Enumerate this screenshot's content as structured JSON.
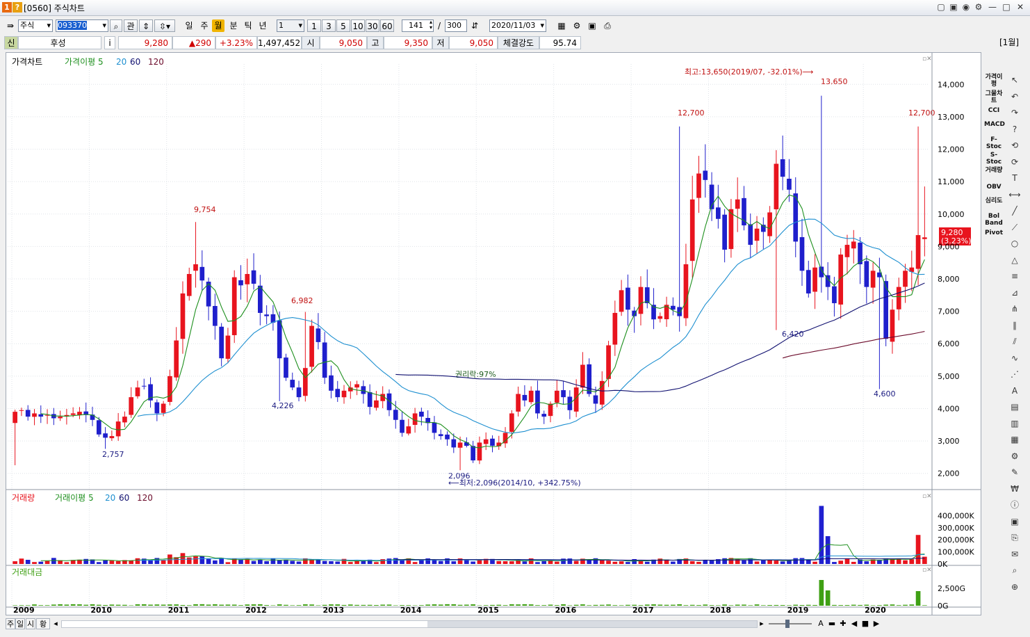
{
  "window": {
    "badge1": "1",
    "badge2": "?",
    "title": "[0560] 주식차트",
    "controls": [
      "▢",
      "▣",
      "◉",
      "⚙",
      "—",
      "□",
      "✕"
    ]
  },
  "toolbar": {
    "market": "주식",
    "code": "093370",
    "search_icon": "magnifier-icon",
    "gwan": "관",
    "periods": [
      "일",
      "주",
      "월",
      "분",
      "틱",
      "년"
    ],
    "selected_period": "월",
    "interval_value": "1",
    "intervals": [
      "1",
      "3",
      "5",
      "10",
      "30",
      "60"
    ],
    "count": "141",
    "slash": "/",
    "total": "300",
    "date": "2020/11/03"
  },
  "quote": {
    "sin": "신",
    "name": "후성",
    "info": "i",
    "price": "9,280",
    "change": "▲290",
    "change_pct": "+3.23%",
    "volume": "1,497,452",
    "open_label": "시",
    "open": "9,050",
    "high_label": "고",
    "high": "9,350",
    "low_label": "저",
    "low": "9,050",
    "strength_label": "체결강도",
    "strength": "95.74",
    "period_badge": "[1월]"
  },
  "colors": {
    "up": "#e8141e",
    "down": "#1f1fcc",
    "ma5": "#1d8f1d",
    "ma20": "#1d8fd0",
    "ma60": "#101070",
    "ma120": "#6b0a2a",
    "volume_up": "#e8141e",
    "volume_down": "#2020d0",
    "amount": "#3fa014"
  },
  "chart_data": [
    {
      "type": "candlestick",
      "title": "가격차트",
      "legend": [
        "가격차트",
        "가격이평 5",
        "20",
        "60",
        "120"
      ],
      "x_labels": [
        "2009",
        "2010",
        "2011",
        "2012",
        "2013",
        "2014",
        "2015",
        "2016",
        "2017",
        "2018",
        "2019",
        "2020"
      ],
      "y_ticks": [
        "14,000",
        "13,000",
        "12,000",
        "11,000",
        "10,000",
        "9,000",
        "8,000",
        "7,000",
        "6,000",
        "5,000",
        "4,000",
        "3,000",
        "2,000"
      ],
      "ylim": [
        1500,
        14500
      ],
      "monthly_close": [
        3900,
        3950,
        3750,
        3850,
        3750,
        3800,
        3700,
        3750,
        3800,
        3850,
        3900,
        3800,
        3650,
        3200,
        3100,
        3150,
        3600,
        3750,
        4350,
        4650,
        4700,
        4250,
        3850,
        4150,
        5000,
        6100,
        7550,
        8150,
        8450,
        7950,
        7150,
        6550,
        5550,
        6250,
        8050,
        7800,
        8150,
        7850,
        6950,
        6850,
        6650,
        5550,
        4950,
        4650,
        4350,
        5250,
        6550,
        6050,
        4950,
        4550,
        4350,
        4550,
        4650,
        4750,
        4450,
        4050,
        4250,
        4450,
        3950,
        3650,
        3250,
        3450,
        3850,
        3750,
        3550,
        3250,
        3150,
        3050,
        2800,
        2950,
        2850,
        2400,
        2950,
        3050,
        2850,
        2950,
        3250,
        3850,
        4450,
        4250,
        4550,
        3850,
        3750,
        4150,
        4550,
        4350,
        3950,
        4650,
        5350,
        4450,
        4150,
        4850,
        5950,
        6950,
        7650,
        7050,
        6850,
        7750,
        7250,
        6750,
        6850,
        7200,
        7050,
        6850,
        8450,
        10450,
        11250,
        11050,
        10150,
        9850,
        8900,
        10150,
        10450,
        9650,
        9050,
        9550,
        9450,
        10050,
        11550,
        11150,
        10750,
        9150,
        8250,
        7550,
        8350,
        8050,
        7750,
        7250,
        8750,
        9050,
        9150,
        8450,
        7750,
        8250,
        8050,
        6150,
        7050,
        7750,
        8250,
        8350,
        9350,
        9280
      ],
      "annotations": {
        "high_label": "최고:13,650(2019/07, -32.01%)⟶",
        "low_label": "⟵최저:2,096(2014/10, +342.75%)",
        "ex_rights": "권리락:97%",
        "peaks": [
          "9,754",
          "6,982",
          "12,700",
          "13,650",
          "12,700"
        ],
        "troughs": [
          "2,757",
          "4,226",
          "2,096",
          "6,420",
          "4,600"
        ],
        "last_price": "9,280",
        "last_change": "(3.23%)"
      }
    },
    {
      "type": "bar",
      "title": "거래량",
      "legend": [
        "거래량",
        "거래이평 5",
        "20",
        "60",
        "120"
      ],
      "y_ticks": [
        "400,000K",
        "300,000K",
        "200,000K",
        "100,000K",
        "0K"
      ],
      "ylim": [
        0,
        500000
      ],
      "unit": "K",
      "spikes": {
        "2019/06": 480000,
        "2019/07": 230000,
        "2020/09": 240000,
        "2020/10": 60000
      },
      "typical_level": 30000
    },
    {
      "type": "bar",
      "title": "거래대금",
      "y_ticks": [
        "2,500G",
        "0G"
      ],
      "ylim": [
        0,
        4000
      ],
      "unit": "G",
      "spikes": {
        "2019/06": 3700,
        "2019/07": 2200,
        "2020/09": 2100
      },
      "typical_level": 120
    }
  ],
  "indicators": [
    "가격이평",
    "그물차트",
    "CCI",
    "MACD",
    "F-Stoc",
    "S-Stoc",
    "거래량",
    "OBV",
    "심리도",
    "Bol Band",
    "Pivot"
  ],
  "tools": [
    "pointer-icon",
    "undo-icon",
    "redo-icon",
    "help-icon",
    "rotate-left-icon",
    "rotate-right-icon",
    "text-icon",
    "measure-icon",
    "line-icon",
    "ray-icon",
    "circle-icon",
    "triangle-icon",
    "fibonacci-icon",
    "gann-icon",
    "pitchfork-icon",
    "parallel-icon",
    "channel-icon",
    "wave-icon",
    "speedline-icon",
    "auto-icon",
    "note-icon",
    "chart-icon",
    "compare-icon",
    "settings-icon",
    "tools-icon",
    "price-icon",
    "info-icon",
    "period-icon",
    "copy-icon",
    "excel-icon",
    "zoom-icon",
    "target-icon"
  ],
  "bottom": {
    "left_tabs": [
      "주",
      "일",
      "시",
      "황"
    ],
    "left_arrow": "◂",
    "right_arrow": "▸",
    "nav_symbols": [
      "A",
      "▬",
      "✚",
      "◀",
      "■",
      "▶"
    ]
  }
}
